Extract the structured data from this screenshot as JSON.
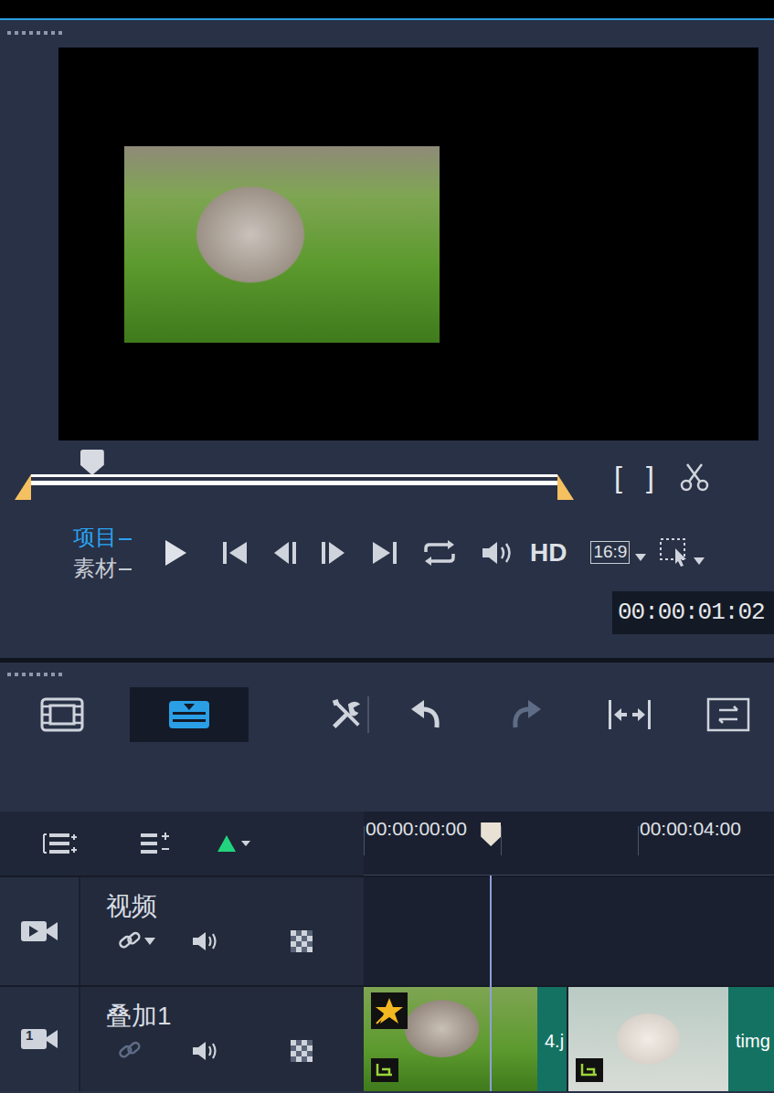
{
  "preview": {
    "scrubber_level": 0.116
  },
  "trim_buttons": [
    {
      "label": "["
    },
    {
      "label": "]"
    }
  ],
  "modes": [
    {
      "label": "项目",
      "selected": true
    },
    {
      "label": "素材",
      "selected": false
    }
  ],
  "player": {
    "hd": "HD",
    "aspect": "16:9",
    "timecode": "00:00:01:02"
  },
  "views": [
    {
      "kind": "storyboard",
      "selected": false
    },
    {
      "kind": "timeline",
      "selected": true
    }
  ],
  "toolbar": {
    "undo_enabled": true,
    "redo_enabled": false
  },
  "timeline": {
    "ruler": [
      "00:00:00:00",
      "00:00:04:00"
    ],
    "playhead_level": 0.31,
    "tracks": [
      {
        "kind": "video",
        "label": "视频",
        "link_enabled": true,
        "clips": []
      },
      {
        "kind": "overlay",
        "label": "叠加1",
        "badge": "1",
        "link_enabled": false,
        "clips": [
          {
            "label": "4.j",
            "starred": true
          },
          {
            "label": "timg",
            "starred": false
          }
        ]
      }
    ]
  }
}
